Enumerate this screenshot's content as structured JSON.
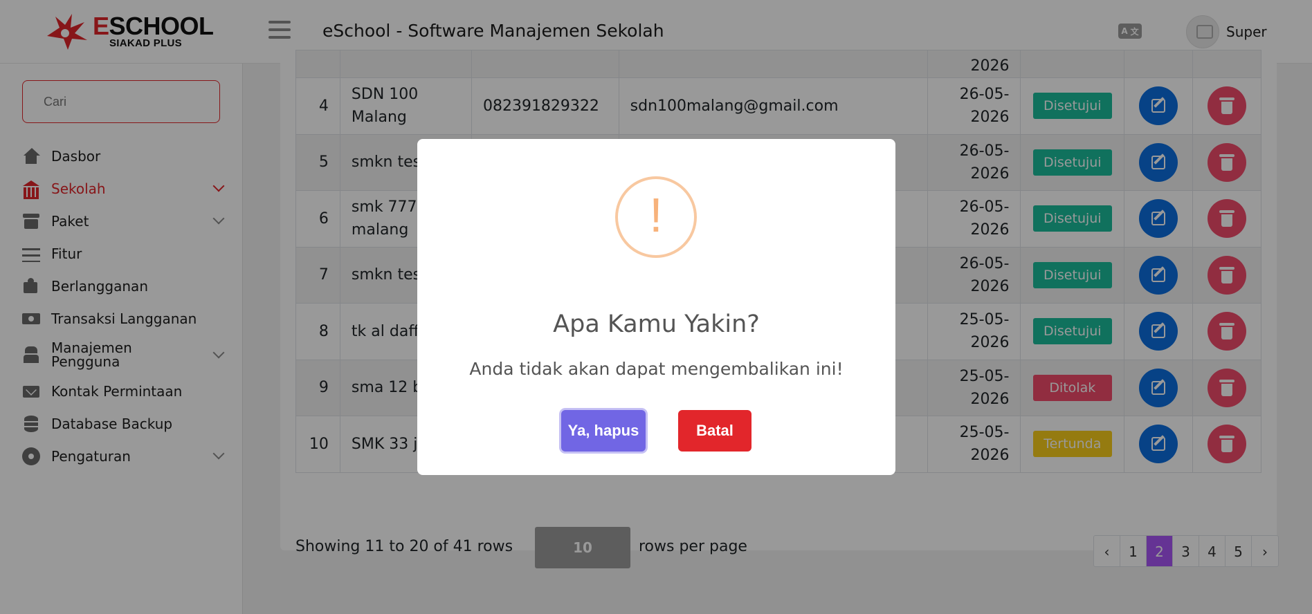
{
  "header": {
    "logo_title": "ESCHOOL",
    "logo_sub": "SIAKAD PLUS",
    "app_title": "eSchool - Software Manajemen Sekolah",
    "username": "Super",
    "lang_icon": "translate-icon"
  },
  "sidebar": {
    "search_placeholder": "Cari",
    "items": [
      {
        "label": "Dasbor",
        "icon": "home-icon"
      },
      {
        "label": "Sekolah",
        "icon": "bank-icon",
        "active": true
      },
      {
        "label": "Paket",
        "icon": "archive-icon"
      },
      {
        "label": "Fitur",
        "icon": "list-icon"
      },
      {
        "label": "Berlangganan",
        "icon": "puzzle-icon"
      },
      {
        "label": "Transaksi Langganan",
        "icon": "money-icon"
      },
      {
        "label": "Manajemen Pengguna",
        "icon": "user-secret-icon"
      },
      {
        "label": "Kontak Permintaan",
        "icon": "envelope-icon"
      },
      {
        "label": "Database Backup",
        "icon": "database-icon"
      },
      {
        "label": "Pengaturan",
        "icon": "gear-icon"
      }
    ]
  },
  "table": {
    "stub_date": "2026",
    "rows": [
      {
        "no": "4",
        "name_l1": "SDN 100",
        "name_l2": "Malang",
        "phone": "082391829322",
        "email": "sdn100malang@gmail.com",
        "date_l1": "26-05-",
        "date_l2": "2026",
        "status": "Disetujui"
      },
      {
        "no": "5",
        "name_l1": "smkn tes",
        "name_l2": "",
        "phone": "",
        "email": "",
        "date_l1": "26-05-",
        "date_l2": "2026",
        "status": "Disetujui"
      },
      {
        "no": "6",
        "name_l1": "smk 777",
        "name_l2": "malang",
        "phone": "",
        "email": "",
        "date_l1": "26-05-",
        "date_l2": "2026",
        "status": "Disetujui"
      },
      {
        "no": "7",
        "name_l1": "smkn tes",
        "name_l2": "",
        "phone": "",
        "email": "",
        "date_l1": "26-05-",
        "date_l2": "2026",
        "status": "Disetujui"
      },
      {
        "no": "8",
        "name_l1": "tk al daff",
        "name_l2": "",
        "phone": "",
        "email": "",
        "date_l1": "25-05-",
        "date_l2": "2026",
        "status": "Disetujui"
      },
      {
        "no": "9",
        "name_l1": "sma 12 b",
        "name_l2": "",
        "phone": "",
        "email": "",
        "date_l1": "25-05-",
        "date_l2": "2026",
        "status": "Ditolak"
      },
      {
        "no": "10",
        "name_l1": "SMK 33 je",
        "name_l2": "",
        "phone": "",
        "email": "",
        "date_l1": "25-05-",
        "date_l2": "2026",
        "status": "Tertunda"
      }
    ]
  },
  "footer": {
    "showing": "Showing 11 to 20 of 41 rows",
    "per_page_value": "10",
    "per_page_label": "rows per page"
  },
  "pagination": [
    "‹",
    "1",
    "2",
    "3",
    "4",
    "5",
    "›"
  ],
  "pagination_active": "2",
  "modal": {
    "icon": "!",
    "title": "Apa Kamu Yakin?",
    "text": "Anda tidak akan dapat mengembalikan ini!",
    "confirm": "Ya, hapus",
    "cancel": "Batal"
  },
  "colors": {
    "brand_red": "#e2262b",
    "approved": "#1cbc9c",
    "rejected": "#f24c6c",
    "pending": "#f9ce1c",
    "edit": "#0c6ee0",
    "confirm": "#7166e4",
    "page_active": "#a855f7"
  }
}
